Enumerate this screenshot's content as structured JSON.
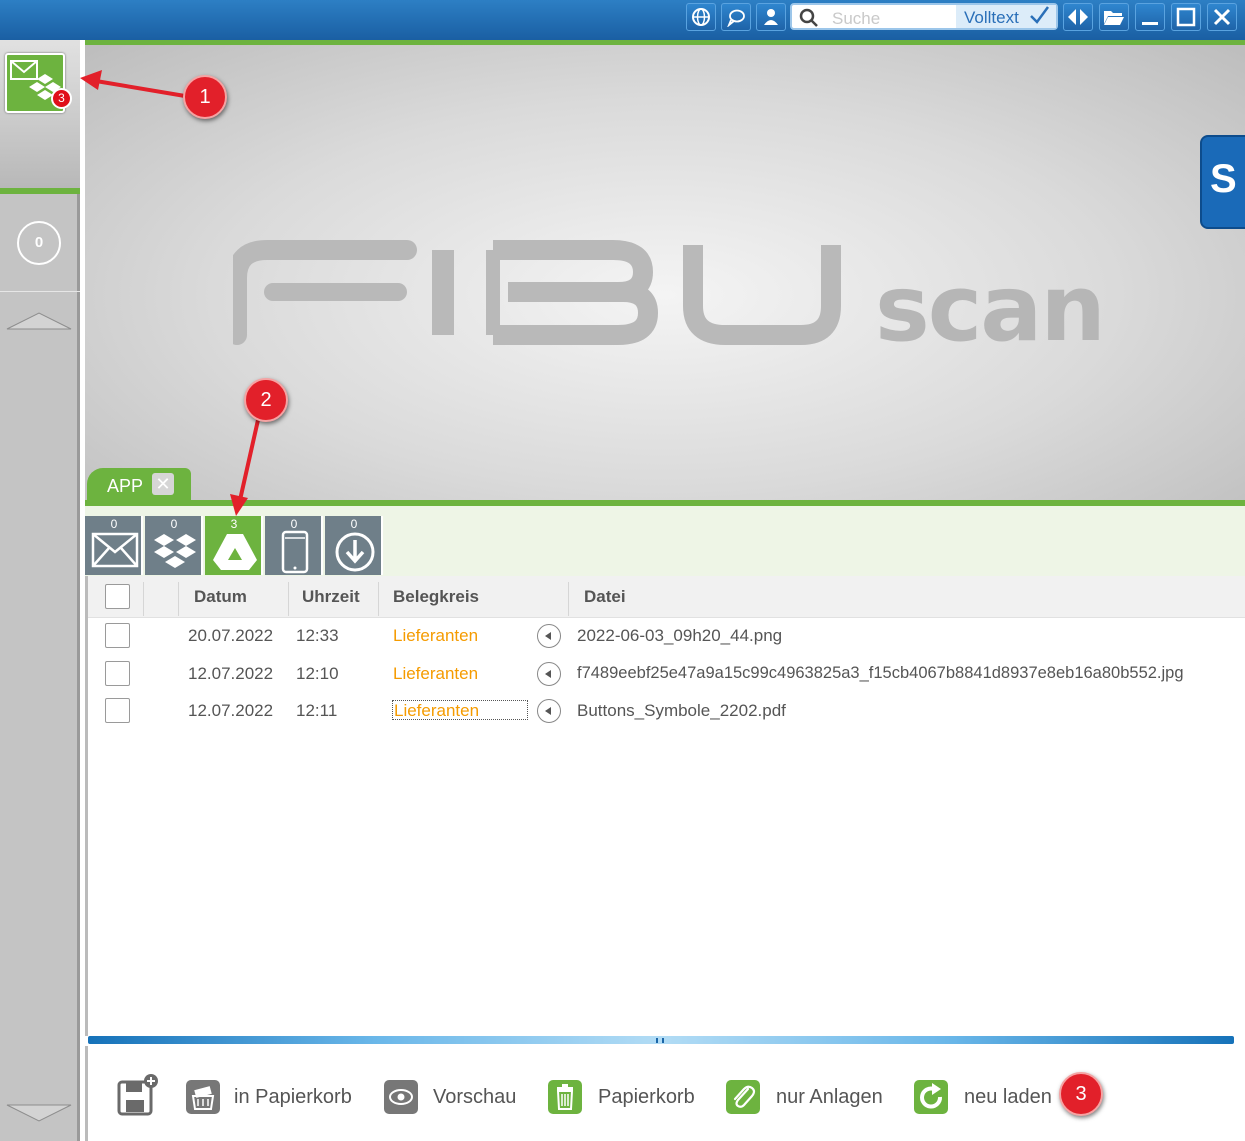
{
  "topbar": {
    "search_placeholder": "Suche",
    "volltext_label": "Volltext",
    "icons": [
      "globe-icon",
      "chat-icon",
      "user-icon",
      "search-icon",
      "expand-arrows-icon",
      "folder-open-icon",
      "minimize-icon",
      "maximize-icon",
      "close-icon"
    ]
  },
  "sidebar": {
    "app_badge_count": "3",
    "counter": "0"
  },
  "logo": {
    "brand": "FIBU",
    "sub": "scan",
    "side_badge": "S"
  },
  "tab": {
    "label": "APP",
    "close": "✕"
  },
  "sources": [
    {
      "name": "email",
      "count": "0",
      "active": false
    },
    {
      "name": "dropbox",
      "count": "0",
      "active": false
    },
    {
      "name": "google-drive",
      "count": "3",
      "active": true
    },
    {
      "name": "mobile",
      "count": "0",
      "active": false
    },
    {
      "name": "download",
      "count": "0",
      "active": false
    }
  ],
  "table": {
    "headers": {
      "datum": "Datum",
      "uhrzeit": "Uhrzeit",
      "belegkreis": "Belegkreis",
      "datei": "Datei"
    },
    "rows": [
      {
        "datum": "20.07.2022",
        "uhrzeit": "12:33",
        "belegkreis": "Lieferanten",
        "datei": "2022-06-03_09h20_44.png"
      },
      {
        "datum": "12.07.2022",
        "uhrzeit": "12:10",
        "belegkreis": "Lieferanten",
        "datei": "f7489eebf25e47a9a15c99c4963825a3_f15cb4067b8841d8937e8eb16a80b552.jpg"
      },
      {
        "datum": "12.07.2022",
        "uhrzeit": "12:11",
        "belegkreis": "Lieferanten",
        "datei": "Buttons_Symbole_2202.pdf"
      }
    ]
  },
  "actions": {
    "papierkorb_in": "in Papierkorb",
    "vorschau": "Vorschau",
    "papierkorb": "Papierkorb",
    "nur_anlagen": "nur Anlagen",
    "neu_laden": "neu laden"
  },
  "markers": [
    "1",
    "2",
    "3"
  ],
  "colors": {
    "accent_green": "#6db33f",
    "title_blue": "#1a5fa3",
    "kreis_orange": "#f59b00",
    "marker_red": "#e2202a"
  }
}
